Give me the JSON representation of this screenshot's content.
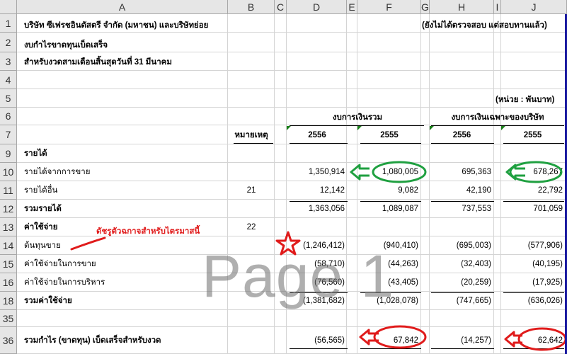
{
  "columns": [
    "A",
    "B",
    "C",
    "D",
    "E",
    "F",
    "G",
    "H",
    "I",
    "J"
  ],
  "rows": [
    "1",
    "2",
    "3",
    "4",
    "5",
    "6",
    "7",
    "9",
    "10",
    "11",
    "12",
    "13",
    "14",
    "15",
    "16",
    "18",
    "35",
    "36"
  ],
  "header": {
    "company": "บริษัท ซีเฟรชอินดัสตรี จำกัด (มหาชน) และบริษัทย่อย",
    "audit_note": "(ยังไม่ได้ตรวจสอบ แต่สอบทานแล้ว)",
    "statement": "งบกำไรขาดทุนเบ็ดเสร็จ",
    "period": "สำหรับงวดสามเดือนสิ้นสุดวันที่ 31 มีนาคม",
    "unit": "(หน่วย : พันบาท)",
    "consolidated": "งบการเงินรวม",
    "separate": "งบการเงินเฉพาะของบริษัท",
    "note_col": "หมายเหตุ",
    "y2556_a": "2556",
    "y2555_a": "2555",
    "y2556_b": "2556",
    "y2555_b": "2555"
  },
  "table": [
    {
      "label": "รายได้",
      "bold": true,
      "note": "",
      "d": "",
      "f": "",
      "h": "",
      "j": ""
    },
    {
      "label": "รายได้จากการขาย",
      "bold": false,
      "note": "",
      "d": "1,350,914",
      "f": "1,080,005",
      "h": "695,363",
      "j": "678,267"
    },
    {
      "label": "รายได้อื่น",
      "bold": false,
      "note": "21",
      "d": "12,142",
      "f": "9,082",
      "h": "42,190",
      "j": "22,792"
    },
    {
      "label": "รวมรายได้",
      "bold": true,
      "note": "",
      "d": "1,363,056",
      "f": "1,089,087",
      "h": "737,553",
      "j": "701,059"
    },
    {
      "label": "ค่าใช้จ่าย",
      "bold": true,
      "note": "22",
      "d": "",
      "f": "",
      "h": "",
      "j": ""
    },
    {
      "label": "ต้นทุนขาย",
      "bold": false,
      "note": "",
      "d": "(1,246,412)",
      "f": "(940,410)",
      "h": "(695,003)",
      "j": "(577,906)"
    },
    {
      "label": "ค่าใช้จ่ายในการขาย",
      "bold": false,
      "note": "",
      "d": "(58,710)",
      "f": "(44,263)",
      "h": "(32,403)",
      "j": "(40,195)"
    },
    {
      "label": "ค่าใช้จ่ายในการบริหาร",
      "bold": false,
      "note": "",
      "d": "(76,560)",
      "f": "(43,405)",
      "h": "(20,259)",
      "j": "(17,925)"
    },
    {
      "label": "รวมค่าใช้จ่าย",
      "bold": true,
      "note": "",
      "d": "(1,381,682)",
      "f": "(1,028,078)",
      "h": "(747,665)",
      "j": "(636,026)"
    },
    {
      "label": "",
      "bold": false,
      "note": "",
      "d": "",
      "f": "",
      "h": "",
      "j": ""
    },
    {
      "label": "รวมกำไร (ขาดทุน) เบ็ดเสร็จสำหรับงวด",
      "bold": true,
      "note": "",
      "d": "(56,565)",
      "f": "67,842",
      "h": "(14,257)",
      "j": "62,642"
    }
  ],
  "annotation": "ดัชรูตัวฉกาจสำหรับไตรมาสนี้",
  "watermark": "Page 1",
  "colors": {
    "green_mark": "#1fa040",
    "red_mark": "#e01b1b",
    "header_gray": "#e6e6e6"
  }
}
